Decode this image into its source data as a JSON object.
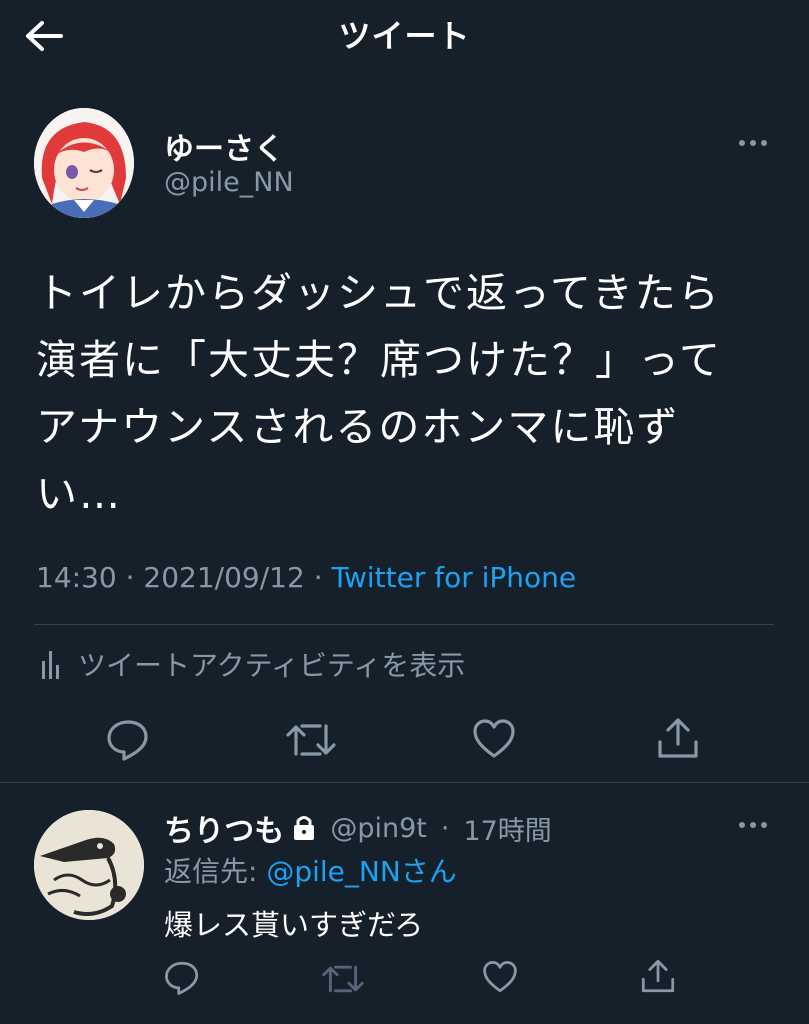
{
  "header": {
    "title": "ツイート",
    "back_icon": "arrow-left-icon"
  },
  "tweet": {
    "author_name": "ゆーさく",
    "author_handle": "@pile_NN",
    "text": "トイレからダッシュで返ってきたら\n演者に「大丈夫？席つけた？」って\nアナウンスされるのホンマに恥ず\nい…",
    "time": "14:30",
    "date": "2021/09/12",
    "separator": " · ",
    "source": "Twitter for iPhone",
    "activity_label": "ツイートアクティビティを表示",
    "actions": [
      "reply-icon",
      "retweet-icon",
      "like-icon",
      "share-icon"
    ]
  },
  "reply": {
    "author_name": "ちりつも",
    "author_handle": "@pin9t",
    "time": "17時間",
    "reply_to_prefix": "返信先: ",
    "reply_to_user": "@pile_NNさん",
    "text": "爆レス貰いすぎだろ"
  },
  "colors": {
    "background": "#15202b",
    "muted": "#8899a6",
    "accent": "#1da1f2",
    "divider": "#38444d"
  }
}
